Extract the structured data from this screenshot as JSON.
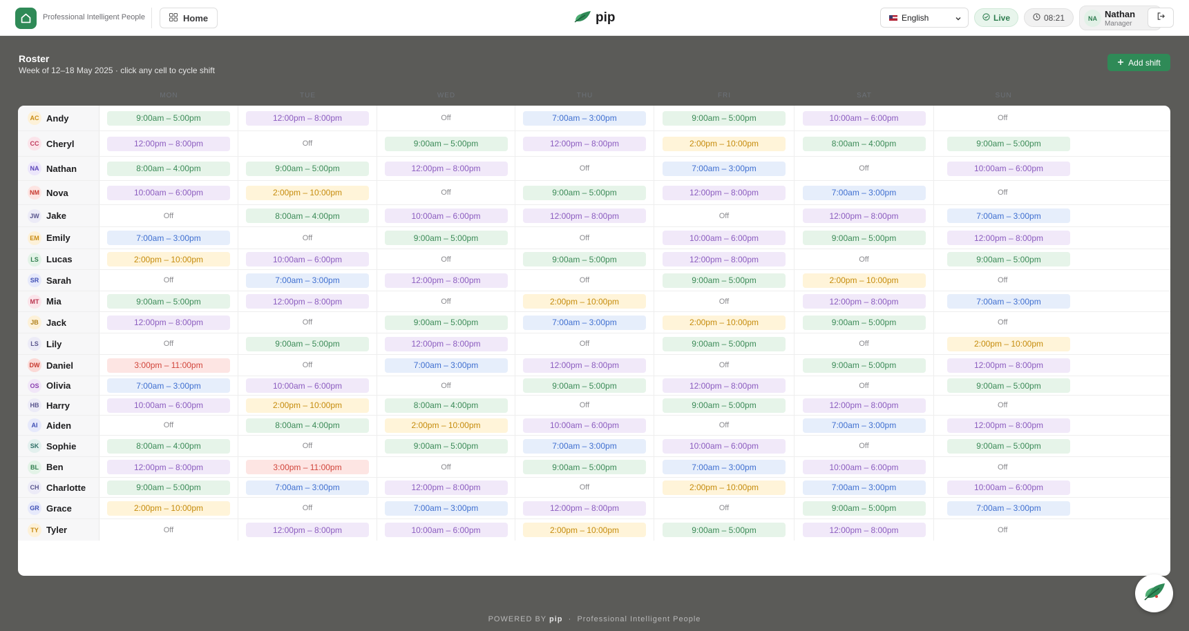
{
  "header": {
    "brand_name": "Professional Intelligent People",
    "home_label": "Home",
    "app_logo_text": "pip",
    "language": "English",
    "live_label": "Live",
    "time": "08:21",
    "user": {
      "initials": "NA",
      "name": "Nathan",
      "role": "Manager"
    }
  },
  "page": {
    "title": "Roster",
    "subtitle": "Week of 12–18 May 2025 · click any cell to cycle shift",
    "add_shift_label": "Add shift"
  },
  "days": [
    "MON",
    "TUE",
    "WED",
    "THU",
    "FRI",
    "SAT",
    "SUN"
  ],
  "shift_colors": {
    "green": "#e6f4e9",
    "purple": "#f1e9f9",
    "blue": "#e6eefb",
    "yellow": "#fff4d9",
    "red": "#fde5e3"
  },
  "employees": [
    {
      "initials": "AC",
      "name": "Andy",
      "avatar_bg": "#fdf1d8",
      "avatar_fg": "#c98b12",
      "shifts": [
        "9:00am – 5:00pm",
        "12:00pm – 8:00pm",
        "Off",
        "7:00am – 3:00pm",
        "9:00am – 5:00pm",
        "10:00am – 6:00pm",
        "Off"
      ]
    },
    {
      "initials": "CC",
      "name": "Cheryl",
      "avatar_bg": "#fbe4ea",
      "avatar_fg": "#c0395c",
      "shifts": [
        "12:00pm – 8:00pm",
        "Off",
        "9:00am – 5:00pm",
        "12:00pm – 8:00pm",
        "2:00pm – 10:00pm",
        "8:00am – 4:00pm",
        "9:00am – 5:00pm"
      ]
    },
    {
      "initials": "NA",
      "name": "Nathan",
      "avatar_bg": "#ece6fb",
      "avatar_fg": "#5b45b8",
      "shifts": [
        "8:00am – 4:00pm",
        "9:00am – 5:00pm",
        "12:00pm – 8:00pm",
        "Off",
        "7:00am – 3:00pm",
        "Off",
        "10:00am – 6:00pm"
      ]
    },
    {
      "initials": "NM",
      "name": "Nova",
      "avatar_bg": "#fde4e2",
      "avatar_fg": "#c7392f",
      "shifts": [
        "10:00am – 6:00pm",
        "2:00pm – 10:00pm",
        "Off",
        "9:00am – 5:00pm",
        "12:00pm – 8:00pm",
        "7:00am – 3:00pm",
        "Off"
      ]
    },
    {
      "initials": "JW",
      "name": "Jake",
      "avatar_bg": "#ecebf7",
      "avatar_fg": "#5a568e",
      "shifts": [
        "Off",
        "8:00am – 4:00pm",
        "10:00am – 6:00pm",
        "12:00pm – 8:00pm",
        "Off",
        "12:00pm – 8:00pm",
        "7:00am – 3:00pm"
      ]
    },
    {
      "initials": "EM",
      "name": "Emily",
      "avatar_bg": "#fdf1d8",
      "avatar_fg": "#c98b12",
      "shifts": [
        "7:00am – 3:00pm",
        "Off",
        "9:00am – 5:00pm",
        "Off",
        "10:00am – 6:00pm",
        "9:00am – 5:00pm",
        "12:00pm – 8:00pm"
      ]
    },
    {
      "initials": "LS",
      "name": "Lucas",
      "avatar_bg": "#e3f3e7",
      "avatar_fg": "#2f7d4d",
      "shifts": [
        "2:00pm – 10:00pm",
        "10:00am – 6:00pm",
        "Off",
        "9:00am – 5:00pm",
        "12:00pm – 8:00pm",
        "Off",
        "9:00am – 5:00pm"
      ]
    },
    {
      "initials": "SR",
      "name": "Sarah",
      "avatar_bg": "#e6e9fb",
      "avatar_fg": "#3f4fb5",
      "shifts": [
        "Off",
        "7:00am – 3:00pm",
        "12:00pm – 8:00pm",
        "Off",
        "9:00am – 5:00pm",
        "2:00pm – 10:00pm",
        "Off"
      ]
    },
    {
      "initials": "MT",
      "name": "Mia",
      "avatar_bg": "#fbe4ea",
      "avatar_fg": "#b8344f",
      "shifts": [
        "9:00am – 5:00pm",
        "12:00pm – 8:00pm",
        "Off",
        "2:00pm – 10:00pm",
        "Off",
        "12:00pm – 8:00pm",
        "7:00am – 3:00pm"
      ]
    },
    {
      "initials": "JB",
      "name": "Jack",
      "avatar_bg": "#fdf1d8",
      "avatar_fg": "#b0801a",
      "shifts": [
        "12:00pm – 8:00pm",
        "Off",
        "9:00am – 5:00pm",
        "7:00am – 3:00pm",
        "2:00pm – 10:00pm",
        "9:00am – 5:00pm",
        "Off"
      ]
    },
    {
      "initials": "LS",
      "name": "Lily",
      "avatar_bg": "#ecebf7",
      "avatar_fg": "#5a568e",
      "shifts": [
        "Off",
        "9:00am – 5:00pm",
        "12:00pm – 8:00pm",
        "Off",
        "9:00am – 5:00pm",
        "Off",
        "2:00pm – 10:00pm"
      ]
    },
    {
      "initials": "DW",
      "name": "Daniel",
      "avatar_bg": "#fbd9d6",
      "avatar_fg": "#c7392f",
      "shifts": [
        "3:00pm – 11:00pm",
        "Off",
        "7:00am – 3:00pm",
        "12:00pm – 8:00pm",
        "Off",
        "9:00am – 5:00pm",
        "12:00pm – 8:00pm"
      ]
    },
    {
      "initials": "OS",
      "name": "Olivia",
      "avatar_bg": "#f1e6f8",
      "avatar_fg": "#8a3fb0",
      "shifts": [
        "7:00am – 3:00pm",
        "10:00am – 6:00pm",
        "Off",
        "9:00am – 5:00pm",
        "12:00pm – 8:00pm",
        "Off",
        "9:00am – 5:00pm"
      ]
    },
    {
      "initials": "HB",
      "name": "Harry",
      "avatar_bg": "#ecebf7",
      "avatar_fg": "#5a568e",
      "shifts": [
        "10:00am – 6:00pm",
        "2:00pm – 10:00pm",
        "8:00am – 4:00pm",
        "Off",
        "9:00am – 5:00pm",
        "12:00pm – 8:00pm",
        "Off"
      ]
    },
    {
      "initials": "AI",
      "name": "Aiden",
      "avatar_bg": "#e6e9fb",
      "avatar_fg": "#3f4fb5",
      "shifts": [
        "Off",
        "8:00am – 4:00pm",
        "2:00pm – 10:00pm",
        "10:00am – 6:00pm",
        "Off",
        "7:00am – 3:00pm",
        "12:00pm – 8:00pm"
      ]
    },
    {
      "initials": "SK",
      "name": "Sophie",
      "avatar_bg": "#e3f0ee",
      "avatar_fg": "#2f6f66",
      "shifts": [
        "8:00am – 4:00pm",
        "Off",
        "9:00am – 5:00pm",
        "7:00am – 3:00pm",
        "10:00am – 6:00pm",
        "Off",
        "9:00am – 5:00pm"
      ]
    },
    {
      "initials": "BL",
      "name": "Ben",
      "avatar_bg": "#e3f3e7",
      "avatar_fg": "#2f7d4d",
      "shifts": [
        "12:00pm – 8:00pm",
        "3:00pm – 11:00pm",
        "Off",
        "9:00am – 5:00pm",
        "7:00am – 3:00pm",
        "10:00am – 6:00pm",
        "Off"
      ]
    },
    {
      "initials": "CH",
      "name": "Charlotte",
      "avatar_bg": "#ecebf7",
      "avatar_fg": "#5a568e",
      "shifts": [
        "9:00am – 5:00pm",
        "7:00am – 3:00pm",
        "12:00pm – 8:00pm",
        "Off",
        "2:00pm – 10:00pm",
        "7:00am – 3:00pm",
        "10:00am – 6:00pm"
      ]
    },
    {
      "initials": "GR",
      "name": "Grace",
      "avatar_bg": "#e6e9fb",
      "avatar_fg": "#3f4fb5",
      "shifts": [
        "2:00pm – 10:00pm",
        "Off",
        "7:00am – 3:00pm",
        "12:00pm – 8:00pm",
        "Off",
        "9:00am – 5:00pm",
        "7:00am – 3:00pm"
      ]
    },
    {
      "initials": "TY",
      "name": "Tyler",
      "avatar_bg": "#fdf1d8",
      "avatar_fg": "#c98b12",
      "shifts": [
        "Off",
        "12:00pm – 8:00pm",
        "10:00am – 6:00pm",
        "2:00pm – 10:00pm",
        "9:00am – 5:00pm",
        "12:00pm – 8:00pm",
        "Off"
      ]
    }
  ],
  "footer": {
    "powered_by": "POWERED BY",
    "brand": "pip",
    "separator": "·",
    "tagline": "Professional Intelligent People"
  }
}
